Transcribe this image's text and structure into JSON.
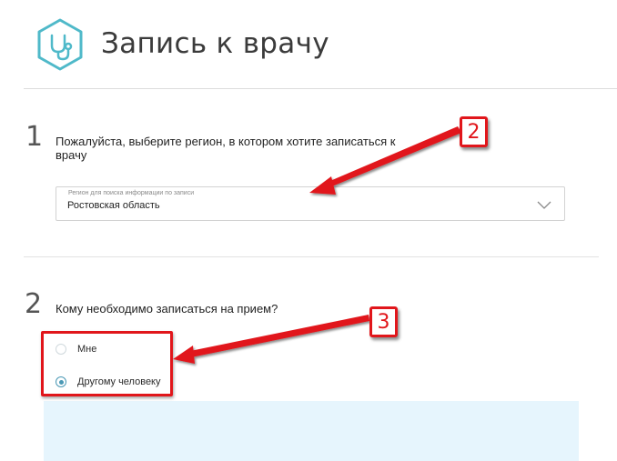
{
  "header": {
    "title": "Запись к врачу",
    "logo_icon": "stethoscope-icon",
    "accent_color": "#4fb9c9"
  },
  "step1": {
    "number": "1",
    "question": "Пожалуйста, выберите регион, в котором хотите записаться к врачу",
    "select": {
      "label": "Регион для поиска информации по записи",
      "value": "Ростовская область",
      "icon": "chevron-down-icon"
    }
  },
  "step2": {
    "number": "2",
    "question": "Кому необходимо записаться на прием?",
    "options": [
      {
        "label": "Мне",
        "checked": false
      },
      {
        "label": "Другому человеку",
        "checked": true
      }
    ],
    "checked_color": "#4a98b5"
  },
  "annotations": {
    "badge_2": "2",
    "badge_3": "3",
    "color": "#e1161b"
  }
}
